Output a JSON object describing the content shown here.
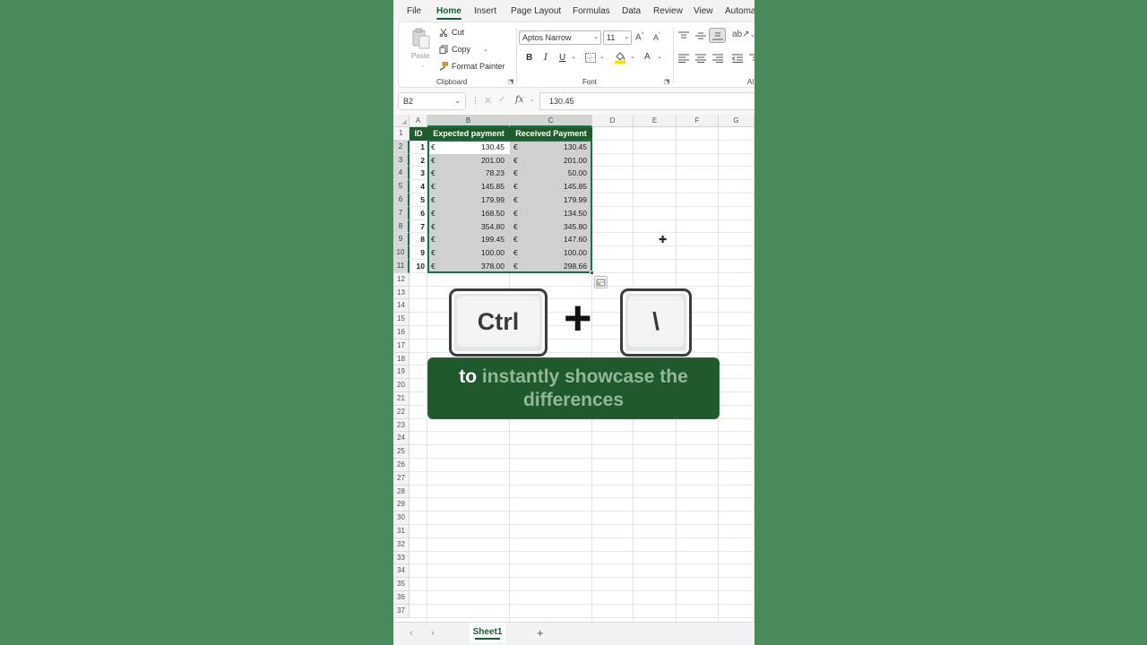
{
  "menu": {
    "tabs": [
      "File",
      "Home",
      "Insert",
      "Page Layout",
      "Formulas",
      "Data",
      "Review",
      "View",
      "Automa"
    ],
    "active": "Home"
  },
  "ribbon": {
    "clipboard": {
      "paste": "Paste",
      "cut": "Cut",
      "copy": "Copy",
      "format_painter": "Format Painter",
      "group_label": "Clipboard"
    },
    "font": {
      "font_name": "Aptos Narrow",
      "font_size": "11",
      "bold": "B",
      "italic": "I",
      "underline": "U",
      "group_label": "Font"
    },
    "alignment": {
      "group_label": "Al"
    }
  },
  "formula_bar": {
    "name_box": "B2",
    "fx": "fx",
    "value": "130.45"
  },
  "grid": {
    "columns": [
      "A",
      "B",
      "C",
      "D",
      "E",
      "F",
      "G"
    ],
    "rows": [
      "1",
      "2",
      "3",
      "4",
      "5",
      "6",
      "7",
      "8",
      "9",
      "10",
      "11",
      "12",
      "13",
      "14",
      "15",
      "16",
      "17",
      "18",
      "19",
      "20",
      "21",
      "22",
      "23",
      "24",
      "25",
      "26",
      "27",
      "28",
      "29",
      "30",
      "31",
      "32",
      "33",
      "34",
      "35",
      "36",
      "37"
    ]
  },
  "table": {
    "headers": [
      "ID",
      "Expected payment",
      "Received Payment"
    ],
    "currency": "€",
    "rows": [
      {
        "id": "1",
        "expected": "130.45",
        "received": "130.45"
      },
      {
        "id": "2",
        "expected": "201.00",
        "received": "201.00"
      },
      {
        "id": "3",
        "expected": "78.23",
        "received": "50.00"
      },
      {
        "id": "4",
        "expected": "145.85",
        "received": "145.85"
      },
      {
        "id": "5",
        "expected": "179.99",
        "received": "179.99"
      },
      {
        "id": "6",
        "expected": "168.50",
        "received": "134.50"
      },
      {
        "id": "7",
        "expected": "354.80",
        "received": "345.80"
      },
      {
        "id": "8",
        "expected": "199.45",
        "received": "147.60"
      },
      {
        "id": "9",
        "expected": "100.00",
        "received": "100.00"
      },
      {
        "id": "10",
        "expected": "378.00",
        "received": "298.66"
      }
    ]
  },
  "overlay": {
    "key1": "Ctrl",
    "plus": "+",
    "key2": "\\",
    "caption_highlight": "to",
    "caption_rest": "instantly showcase the differences"
  },
  "sheets": {
    "active": "Sheet1",
    "add": "+"
  },
  "colors": {
    "background": "#4b8a5e",
    "accent": "#185c37",
    "header_fill": "#1e5c2e",
    "selection": "#1e7145"
  }
}
